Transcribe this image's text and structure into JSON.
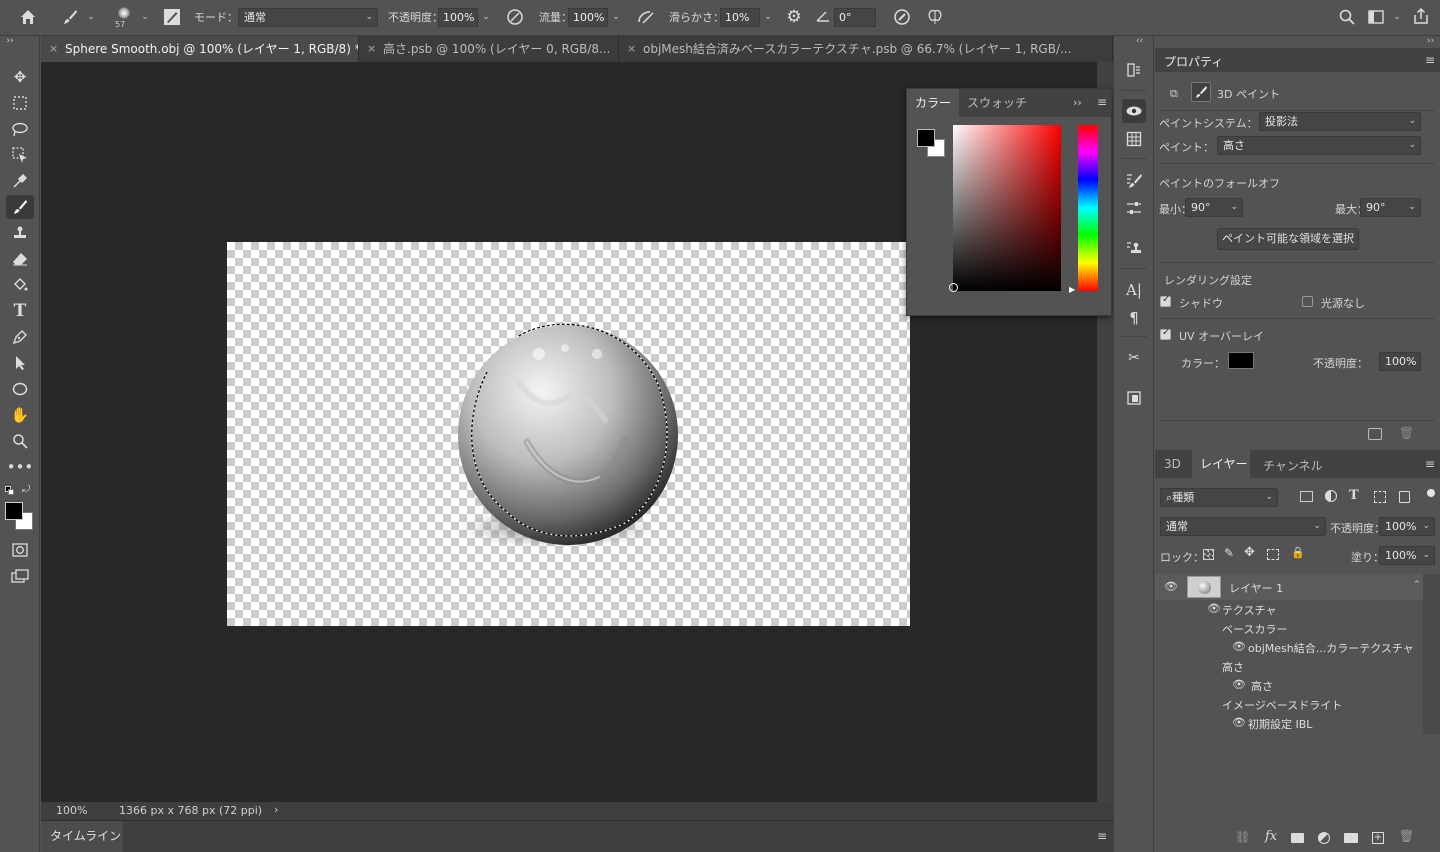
{
  "optbar": {
    "brush_size": "57",
    "mode_label": "モード：",
    "mode_value": "通常",
    "opacity_label": "不透明度：",
    "opacity_value": "100%",
    "flow_label": "流量：",
    "flow_value": "100%",
    "smooth_label": "滑らかさ：",
    "smooth_value": "10%",
    "angle_value": "0°"
  },
  "tabs": [
    {
      "label": "Sphere Smooth.obj @ 100% (レイヤー 1, RGB/8) *"
    },
    {
      "label": "高さ.psb @ 100% (レイヤー 0, RGB/8..."
    },
    {
      "label": "objMesh結合済みベースカラーテクスチャ.psb @ 66.7% (レイヤー 1, RGB/..."
    }
  ],
  "status": {
    "zoom": "100%",
    "size": "1366 px x 768 px (72 ppi)",
    "arrow": "›"
  },
  "timeline": {
    "label": "タイムライン"
  },
  "color_panel": {
    "tabs": [
      "カラー",
      "スウォッチ"
    ],
    "more": "››"
  },
  "properties": {
    "title": "プロパティ",
    "section": "3D ペイント",
    "paint_system_label": "ペイントシステム：",
    "paint_system_value": "投影法",
    "paint_label": "ペイント：",
    "paint_value": "高さ",
    "falloff_title": "ペイントのフォールオフ",
    "min_label": "最小：",
    "min_value": "90°",
    "max_label": "最大：",
    "max_value": "90°",
    "select_button": "ペイント可能な領域を選択",
    "render_title": "レンダリング設定",
    "shadow_label": "シャドウ",
    "no_light_label": "光源なし",
    "uv_label": "UV オーバーレイ",
    "color_label": "カラー：",
    "uv_opacity_label": "不透明度：",
    "uv_opacity_value": "100%",
    "uv_color": "#000000"
  },
  "layers": {
    "tabs": [
      "3D",
      "レイヤー",
      "チャンネル"
    ],
    "filter_value": "種類",
    "blend_value": "通常",
    "opacity_label": "不透明度：",
    "opacity_value": "100%",
    "lock_label": "ロック：",
    "fill_label": "塗り：",
    "fill_value": "100%",
    "items": {
      "layer1": "レイヤー 1",
      "texture": "テクスチャ",
      "base_color": "ベースカラー",
      "objmesh": "objMesh結合...カラーテクスチャ",
      "height_group": "高さ",
      "height_item": "高さ",
      "ibl_group": "イメージベースドライト",
      "ibl_item": "初期設定 IBL"
    }
  }
}
